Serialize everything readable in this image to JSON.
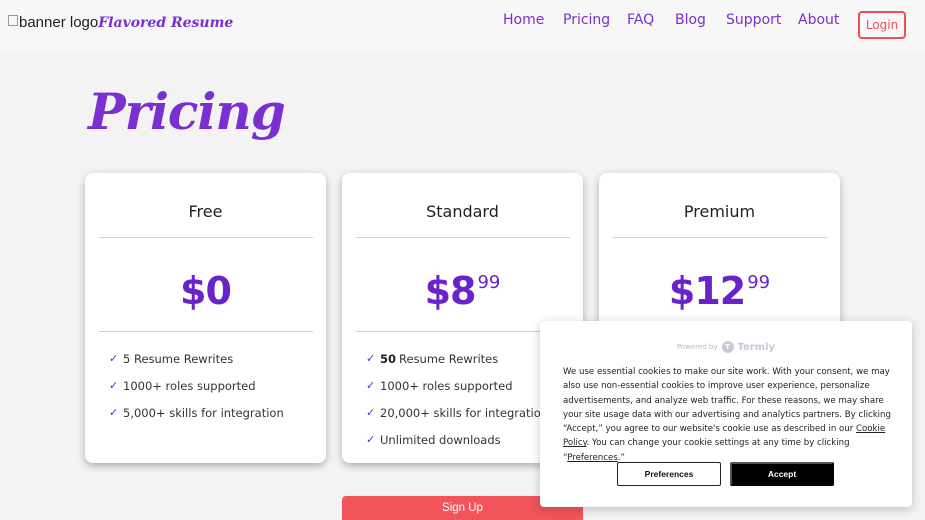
{
  "header": {
    "logo_alt": "banner logo",
    "brand_name": "Flavored Resume",
    "nav": [
      "Home",
      "Pricing",
      "FAQ",
      "Blog",
      "Support",
      "About"
    ],
    "login_label": "Login"
  },
  "page_title": "Pricing",
  "plans": [
    {
      "name": "Free",
      "price_main": "$0",
      "price_cents": "",
      "features": [
        {
          "bold": "",
          "text": "5 Resume Rewrites"
        },
        {
          "bold": "",
          "text": "1000+ roles supported"
        },
        {
          "bold": "",
          "text": "5,000+ skills for integration"
        }
      ]
    },
    {
      "name": "Standard",
      "price_main": "$8",
      "price_cents": "99",
      "features": [
        {
          "bold": "50",
          "text": "Resume Rewrites"
        },
        {
          "bold": "",
          "text": "1000+ roles supported"
        },
        {
          "bold": "",
          "text": "20,000+ skills for integration"
        },
        {
          "bold": "",
          "text": "Unlimited downloads"
        }
      ]
    },
    {
      "name": "Premium",
      "price_main": "$12",
      "price_cents": "99",
      "features": []
    }
  ],
  "signup_label": "Sign Up",
  "cookie_banner": {
    "powered_by": "Powered by",
    "termly_icon": "T",
    "provider": "Termly",
    "text_1": "We use essential cookies to make our site work. With your consent, we may also use non-essential cookies to improve user experience, personalize advertisements, and analyze web traffic. For these reasons, we may share your site usage data with our advertising and analytics partners. By clicking “Accept,” you agree to our website's cookie use as described in our ",
    "cookie_policy_link": "Cookie Policy",
    "text_2": ". You can change your cookie settings at any time by clicking “",
    "preferences_link": "Preferences",
    "text_3": ".”",
    "preferences_button": "Preferences",
    "accept_button": "Accept"
  },
  "colors": {
    "brand_purple": "#7a2fd0",
    "price_purple": "#6a23c8",
    "login_red": "#ef4d58",
    "signup_red": "#f2545b",
    "accept_black": "#000000"
  },
  "icons": {
    "check": "check-icon",
    "broken_image": "broken-image-icon"
  }
}
